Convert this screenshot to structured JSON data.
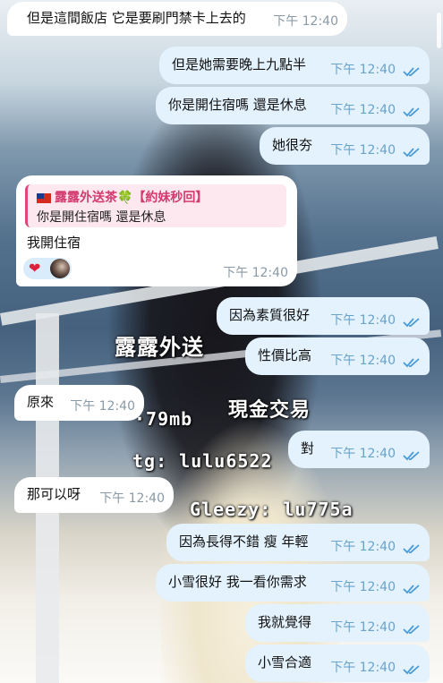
{
  "messages": [
    {
      "side": "in",
      "text": "但是這間飯店 它是要刷門禁卡上去的",
      "time": "下午 12:40"
    },
    {
      "side": "out",
      "text": "但是她需要晚上九點半",
      "time": "下午 12:40"
    },
    {
      "side": "out",
      "text": "你是開住宿嗎 還是休息",
      "time": "下午 12:40"
    },
    {
      "side": "out",
      "text": "她很夯",
      "time": "下午 12:40"
    },
    {
      "side": "out",
      "text": "因為素質很好",
      "time": "下午 12:40"
    },
    {
      "side": "out",
      "text": "性價比高",
      "time": "下午 12:40"
    },
    {
      "side": "in",
      "text": "原來",
      "time": "下午 12:40"
    },
    {
      "side": "out",
      "text": "對",
      "time": "下午 12:40"
    },
    {
      "side": "in",
      "text": "那可以呀",
      "time": "下午 12:40"
    },
    {
      "side": "out",
      "text": "因為長得不錯 瘦 年輕",
      "time": "下午 12:40"
    },
    {
      "side": "out",
      "text": "小雪很好 我一看你需求",
      "time": "下午 12:40"
    },
    {
      "side": "out",
      "text": "我就覺得",
      "time": "下午 12:40"
    },
    {
      "side": "out",
      "text": "小雪合適",
      "time": "下午 12:40"
    }
  ],
  "reply": {
    "quote_title": "露露外送茶🍀【約妹秒回】",
    "quote_text": "你是開住宿嗎 還是休息",
    "text": "我開住宿",
    "time": "下午 12:40",
    "reaction_icons": [
      "heart-icon",
      "avatar"
    ]
  },
  "watermarks": {
    "brand": "露露外送",
    "cash": "現金交易",
    "size": "·79mb",
    "tg": "tg: lulu6522",
    "gleezy": "Gleezy: lu775a"
  },
  "colors": {
    "outgoing_bubble": "#e3f2fd",
    "incoming_bubble": "#ffffff",
    "quote_accent": "#e2457a",
    "check_color": "#4a9bd6"
  },
  "icons": {
    "read_receipt": "double-check-icon"
  }
}
